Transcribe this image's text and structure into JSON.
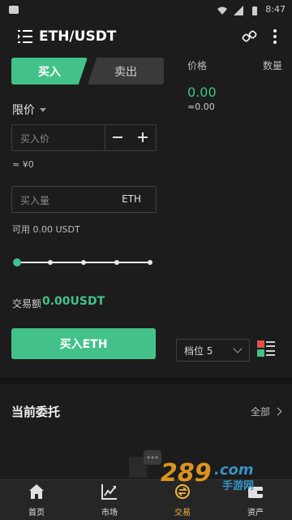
{
  "status_bar": {
    "time": "8:47"
  },
  "header": {
    "pair": "ETH/USDT"
  },
  "trade_tabs": {
    "buy": "买入",
    "sell": "卖出"
  },
  "order_book": {
    "price_label": "价格",
    "qty_label": "数量",
    "last_price": "0.00",
    "last_price_approx": "≈0.00"
  },
  "order_form": {
    "order_type": "限价",
    "price_placeholder": "买入价",
    "price_approx": "≈ ¥0",
    "qty_placeholder": "买入量",
    "qty_unit": "ETH",
    "available": "可用 0.00 USDT",
    "slider_value": 0,
    "amount_label": "交易额",
    "amount_value": "0.00USDT",
    "submit_label": "买入ETH"
  },
  "depth": {
    "label": "档位 5"
  },
  "open_orders": {
    "title": "当前委托",
    "all_label": "全部"
  },
  "nav": {
    "items": [
      {
        "label": "首页",
        "icon": "home-icon"
      },
      {
        "label": "市场",
        "icon": "market-chart-icon"
      },
      {
        "label": "交易",
        "icon": "trade-icon",
        "active": true
      },
      {
        "label": "资产",
        "icon": "wallet-icon"
      }
    ]
  },
  "watermark": {
    "text": "289.com",
    "subtext": "手游网"
  },
  "colors": {
    "accent_green": "#42c28a",
    "active_tab": "#f3b63a",
    "background": "#1c1c1c"
  }
}
